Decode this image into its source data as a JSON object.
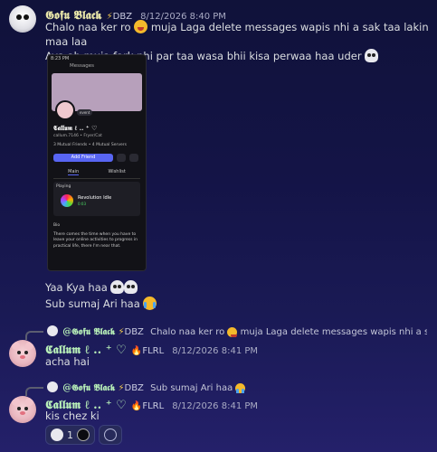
{
  "messages": [
    {
      "author": "𝕲𝖔𝖋𝖚 𝕭𝖑𝖆𝖈𝖐",
      "tag": "DBZ",
      "time": "8/12/2026 8:40 PM",
      "lines": [
        "Chalo naa ker ro",
        "muja Laga delete messages wapis nhi a sak taa lakin maa laa",
        "Aya ab muja fark nhi par taa wasa bhii kisa perwaa haa uder"
      ],
      "after_lines": [
        "Yaa Kya haa",
        "Sub sumaj Ari haa"
      ]
    },
    {
      "reply_author": "@𝕲𝖔𝖋𝖚 𝕭𝖑𝖆𝖈𝖐",
      "reply_tag": "DBZ",
      "reply_text": "Chalo naa ker ro",
      "reply_text_tail": "muja Laga delete messages wapis nhi a sak taa l...",
      "author": "𝕮𝖆𝖑𝖑𝖚𝖒 ℓ .. ⁺ ♡",
      "tag": "FLRL",
      "time": "8/12/2026 8:41 PM",
      "text": "acha hai"
    },
    {
      "reply_author": "@𝕲𝖔𝖋𝖚 𝕭𝖑𝖆𝖈𝖐",
      "reply_tag": "DBZ",
      "reply_text": "Sub sumaj Ari haa",
      "author": "𝕮𝖆𝖑𝖑𝖚𝖒 ℓ .. ⁺ ♡",
      "tag": "FLRL",
      "time": "8/12/2026 8:41 PM",
      "text": "kis chez ki"
    }
  ],
  "screenshot": {
    "status_time": "8:23 PM",
    "header": "Messages",
    "bubble": "event",
    "username": "𝕮𝖆𝖑𝖑𝖚𝖒 ℓ .. ⁺ ♡",
    "subline": "callum.7146 • Fryer/Cat",
    "mutual": "3 Mutual Friends • 4 Mutual Servers",
    "add_friend": "Add Friend",
    "tab_main": "Main",
    "tab_wishlist": "Wishlist",
    "playing_label": "Playing",
    "game": "Revolution Idle",
    "game_time": "0:03",
    "bio_label": "Bio",
    "bio": "There comes the time when you have to leave your online activities to progress in practical life, there I'm near that."
  },
  "reactions": [
    {
      "icon": "skull-icon",
      "count": "1"
    }
  ]
}
